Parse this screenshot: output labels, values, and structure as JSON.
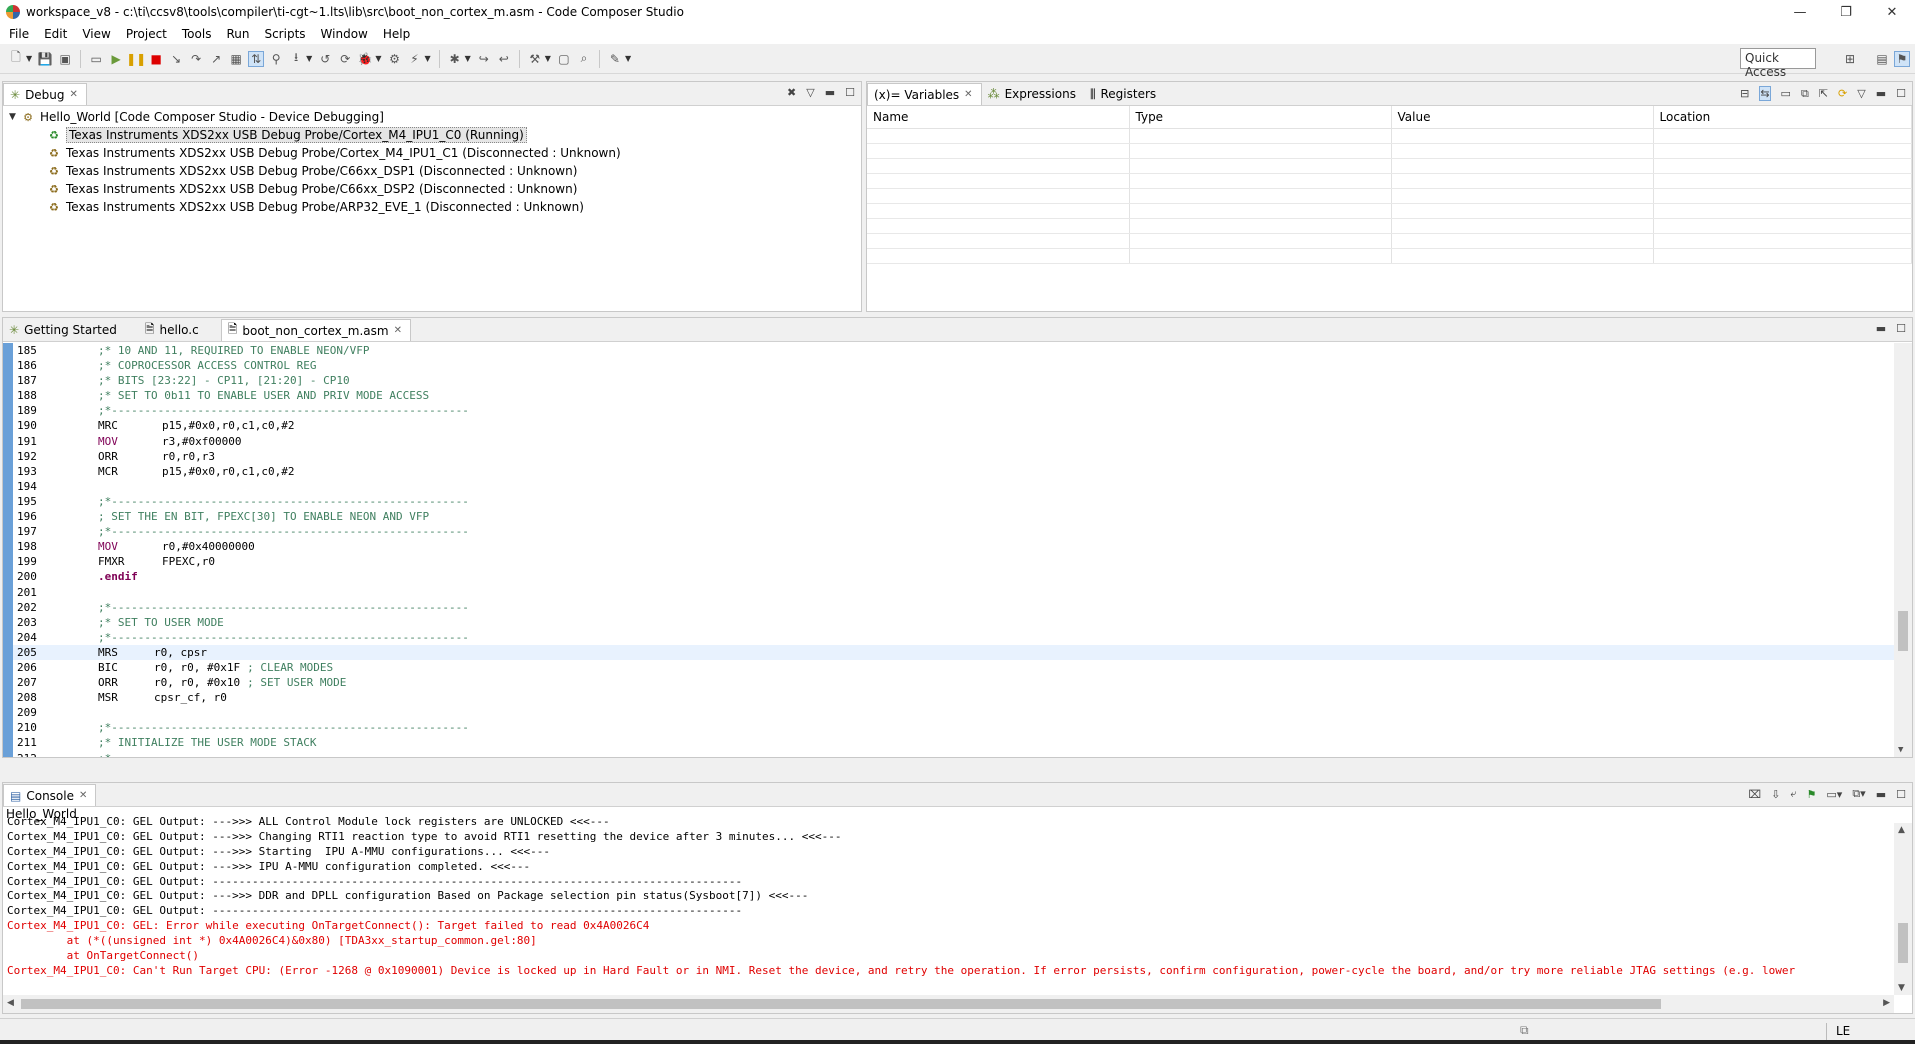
{
  "window": {
    "title": "workspace_v8 - c:\\ti\\ccsv8\\tools\\compiler\\ti-cgt~1.lts\\lib\\src\\boot_non_cortex_m.asm - Code Composer Studio",
    "minimize": "—",
    "maximize": "❐",
    "close": "✕"
  },
  "menu": [
    "File",
    "Edit",
    "View",
    "Project",
    "Tools",
    "Run",
    "Scripts",
    "Window",
    "Help"
  ],
  "quick_access": "Quick Access",
  "debug_view": {
    "tab_label": "Debug",
    "root": "Hello_World [Code Composer Studio - Device Debugging]",
    "items": [
      "Texas Instruments XDS2xx USB Debug Probe/Cortex_M4_IPU1_C0 (Running)",
      "Texas Instruments XDS2xx USB Debug Probe/Cortex_M4_IPU1_C1 (Disconnected : Unknown)",
      "Texas Instruments XDS2xx USB Debug Probe/C66xx_DSP1 (Disconnected : Unknown)",
      "Texas Instruments XDS2xx USB Debug Probe/C66xx_DSP2 (Disconnected : Unknown)",
      "Texas Instruments XDS2xx USB Debug Probe/ARP32_EVE_1 (Disconnected : Unknown)"
    ]
  },
  "variables_view": {
    "tabs": [
      "(x)= Variables",
      "Expressions",
      "Registers"
    ],
    "columns": [
      "Name",
      "Type",
      "Value",
      "Location"
    ]
  },
  "editor": {
    "tabs": [
      "Getting Started",
      "hello.c",
      "boot_non_cortex_m.asm"
    ],
    "lines": [
      {
        "n": "185",
        "t": "        ;* 10 AND 11, REQUIRED TO ENABLE NEON/VFP",
        "k": "comment"
      },
      {
        "n": "186",
        "t": "        ;* COPROCESSOR ACCESS CONTROL REG",
        "k": "comment"
      },
      {
        "n": "187",
        "t": "        ;* BITS [23:22] - CP11, [21:20] - CP10",
        "k": "comment"
      },
      {
        "n": "188",
        "t": "        ;* SET TO 0b11 TO ENABLE USER AND PRIV MODE ACCESS",
        "k": "comment"
      },
      {
        "n": "189",
        "t": "        ;*------------------------------------------------------",
        "k": "comment"
      },
      {
        "n": "190",
        "op": "MRC",
        "args": "p15,#0x0,r0,c1,c0,#2",
        "k": "instr"
      },
      {
        "n": "191",
        "op": "MOV",
        "args": "r3,#0xf00000",
        "k": "instr-kw"
      },
      {
        "n": "192",
        "op": "ORR",
        "args": "r0,r0,r3",
        "k": "instr"
      },
      {
        "n": "193",
        "op": "MCR",
        "args": "p15,#0x0,r0,c1,c0,#2",
        "k": "instr"
      },
      {
        "n": "194",
        "t": "",
        "k": "plain"
      },
      {
        "n": "195",
        "t": "        ;*------------------------------------------------------",
        "k": "comment"
      },
      {
        "n": "196",
        "t": "        ; SET THE EN BIT, FPEXC[30] TO ENABLE NEON AND VFP",
        "k": "comment"
      },
      {
        "n": "197",
        "t": "        ;*------------------------------------------------------",
        "k": "comment"
      },
      {
        "n": "198",
        "op": "MOV",
        "args": "r0,#0x40000000",
        "k": "instr-kw"
      },
      {
        "n": "199",
        "op": "FMXR",
        "args": "FPEXC,r0",
        "k": "instr"
      },
      {
        "n": "200",
        "t": "        .endif",
        "k": "directive"
      },
      {
        "n": "201",
        "t": "",
        "k": "plain"
      },
      {
        "n": "202",
        "t": "        ;*------------------------------------------------------",
        "k": "comment"
      },
      {
        "n": "203",
        "t": "        ;* SET TO USER MODE",
        "k": "comment"
      },
      {
        "n": "204",
        "t": "        ;*------------------------------------------------------",
        "k": "comment"
      },
      {
        "n": "205",
        "op": "MRS",
        "args": "r0, cpsr",
        "k": "instr2",
        "current": true
      },
      {
        "n": "206",
        "op": "BIC",
        "args": "r0, r0, #0x1F",
        "cmt": "; CLEAR MODES",
        "k": "instr2"
      },
      {
        "n": "207",
        "op": "ORR",
        "args": "r0, r0, #0x10",
        "cmt": "; SET USER MODE",
        "k": "instr2"
      },
      {
        "n": "208",
        "op": "MSR",
        "args": "cpsr_cf, r0",
        "k": "instr2"
      },
      {
        "n": "209",
        "t": "",
        "k": "plain"
      },
      {
        "n": "210",
        "t": "        ;*------------------------------------------------------",
        "k": "comment"
      },
      {
        "n": "211",
        "t": "        ;* INITIALIZE THE USER MODE STACK",
        "k": "comment"
      },
      {
        "n": "212",
        "t": "        ;*",
        "k": "comment"
      }
    ]
  },
  "console": {
    "tab_label": "Console",
    "name": "Hello_World",
    "lines": [
      {
        "t": "Cortex_M4_IPU1_C0: GEL Output: --->>> ALL Control Module lock registers are UNLOCKED <<<---",
        "c": "black"
      },
      {
        "t": "Cortex_M4_IPU1_C0: GEL Output: --->>> Changing RTI1 reaction type to avoid RTI1 resetting the device after 3 minutes... <<<---",
        "c": "black"
      },
      {
        "t": "Cortex_M4_IPU1_C0: GEL Output: --->>> Starting  IPU A-MMU configurations... <<<---",
        "c": "black"
      },
      {
        "t": "Cortex_M4_IPU1_C0: GEL Output: --->>> IPU A-MMU configuration completed. <<<---",
        "c": "black"
      },
      {
        "t": "Cortex_M4_IPU1_C0: GEL Output: --------------------------------------------------------------------------------",
        "c": "black"
      },
      {
        "t": "Cortex_M4_IPU1_C0: GEL Output: --->>> DDR and DPLL configuration Based on Package selection pin status(Sysboot[7]) <<<---",
        "c": "black"
      },
      {
        "t": "Cortex_M4_IPU1_C0: GEL Output: --------------------------------------------------------------------------------",
        "c": "black"
      },
      {
        "t": "Cortex_M4_IPU1_C0: GEL: Error while executing OnTargetConnect(): Target failed to read 0x4A0026C4",
        "c": "red"
      },
      {
        "t": "         at (*((unsigned int *) 0x4A0026C4)&0x80) [TDA3xx_startup_common.gel:80]",
        "c": "red"
      },
      {
        "t": "         at OnTargetConnect()",
        "c": "red"
      },
      {
        "t": "Cortex_M4_IPU1_C0: Can't Run Target CPU: (Error -1268 @ 0x1090001) Device is locked up in Hard Fault or in NMI. Reset the device, and retry the operation. If error persists, confirm configuration, power-cycle the board, and/or try more reliable JTAG settings (e.g. lower",
        "c": "red"
      }
    ]
  },
  "status": {
    "endianness": "LE"
  }
}
